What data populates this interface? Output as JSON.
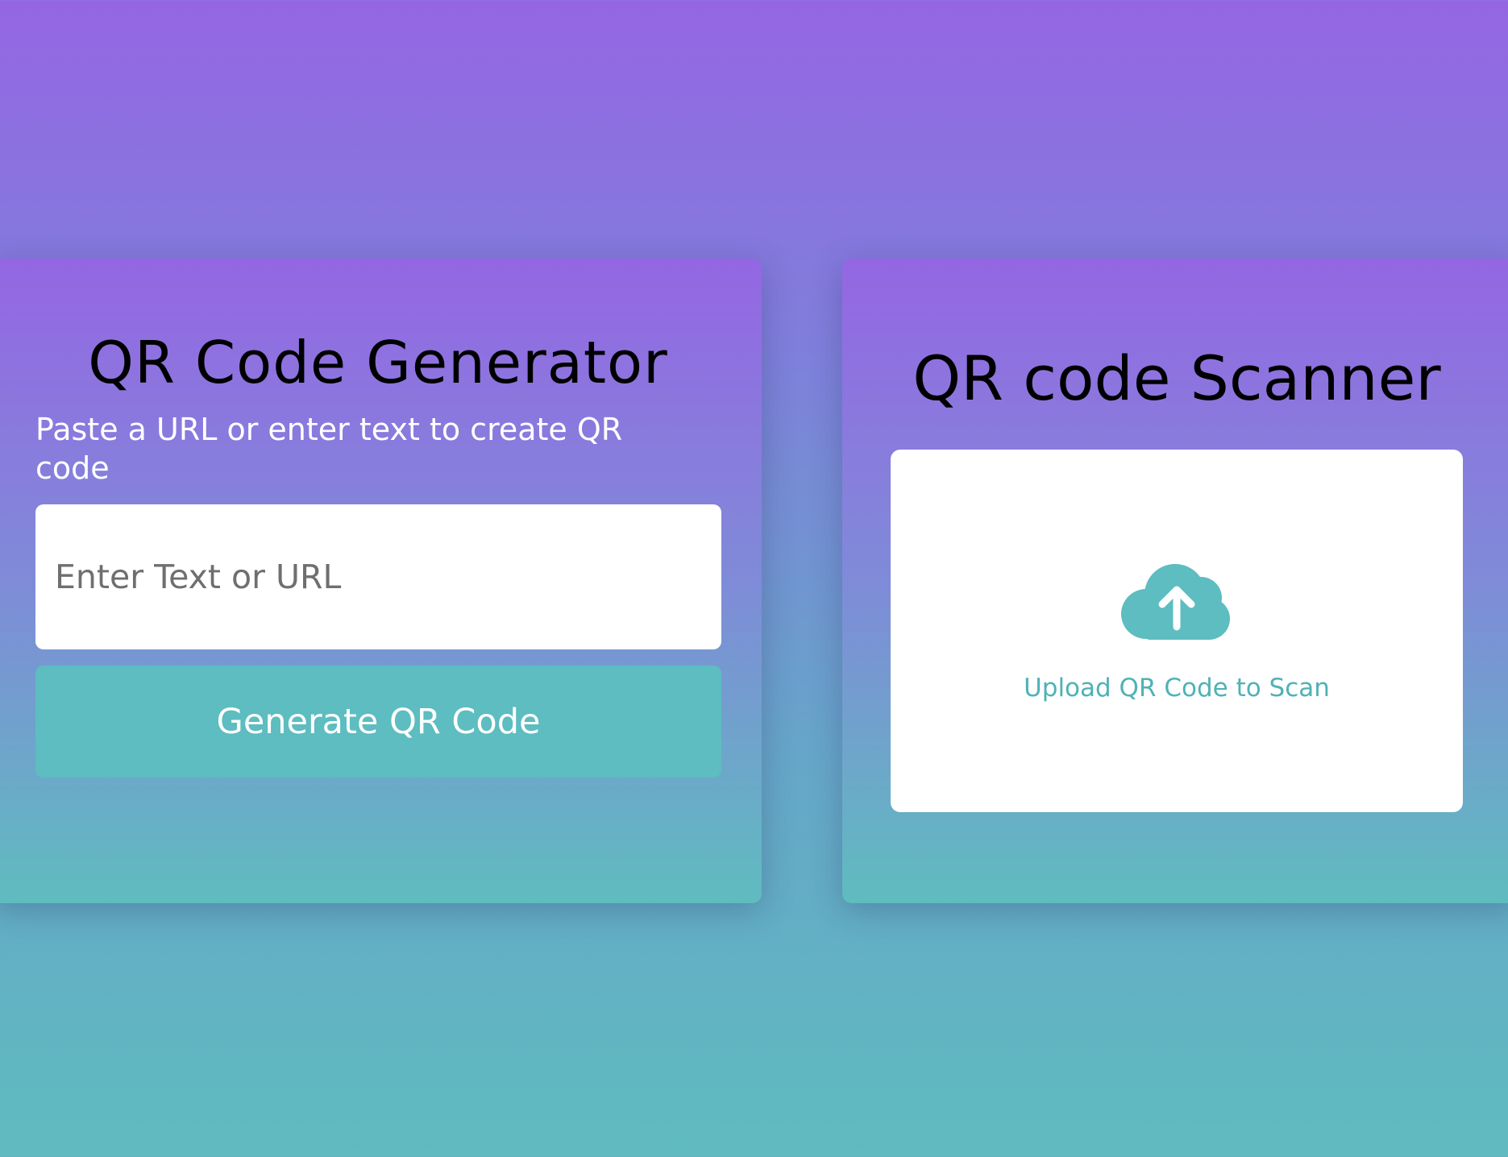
{
  "generator": {
    "title": "QR Code Generator",
    "subtitle": "Paste a URL or enter text to create QR code",
    "input": {
      "placeholder": "Enter Text or URL",
      "value": ""
    },
    "button_label": "Generate QR Code"
  },
  "scanner": {
    "title": "QR code Scanner",
    "upload_label": "Upload QR Code to Scan",
    "upload_icon": "cloud-upload-icon"
  },
  "colors": {
    "accent": "#5dbdc0",
    "gradient_top": "#9566e3",
    "gradient_bottom": "#5fbbbf"
  }
}
